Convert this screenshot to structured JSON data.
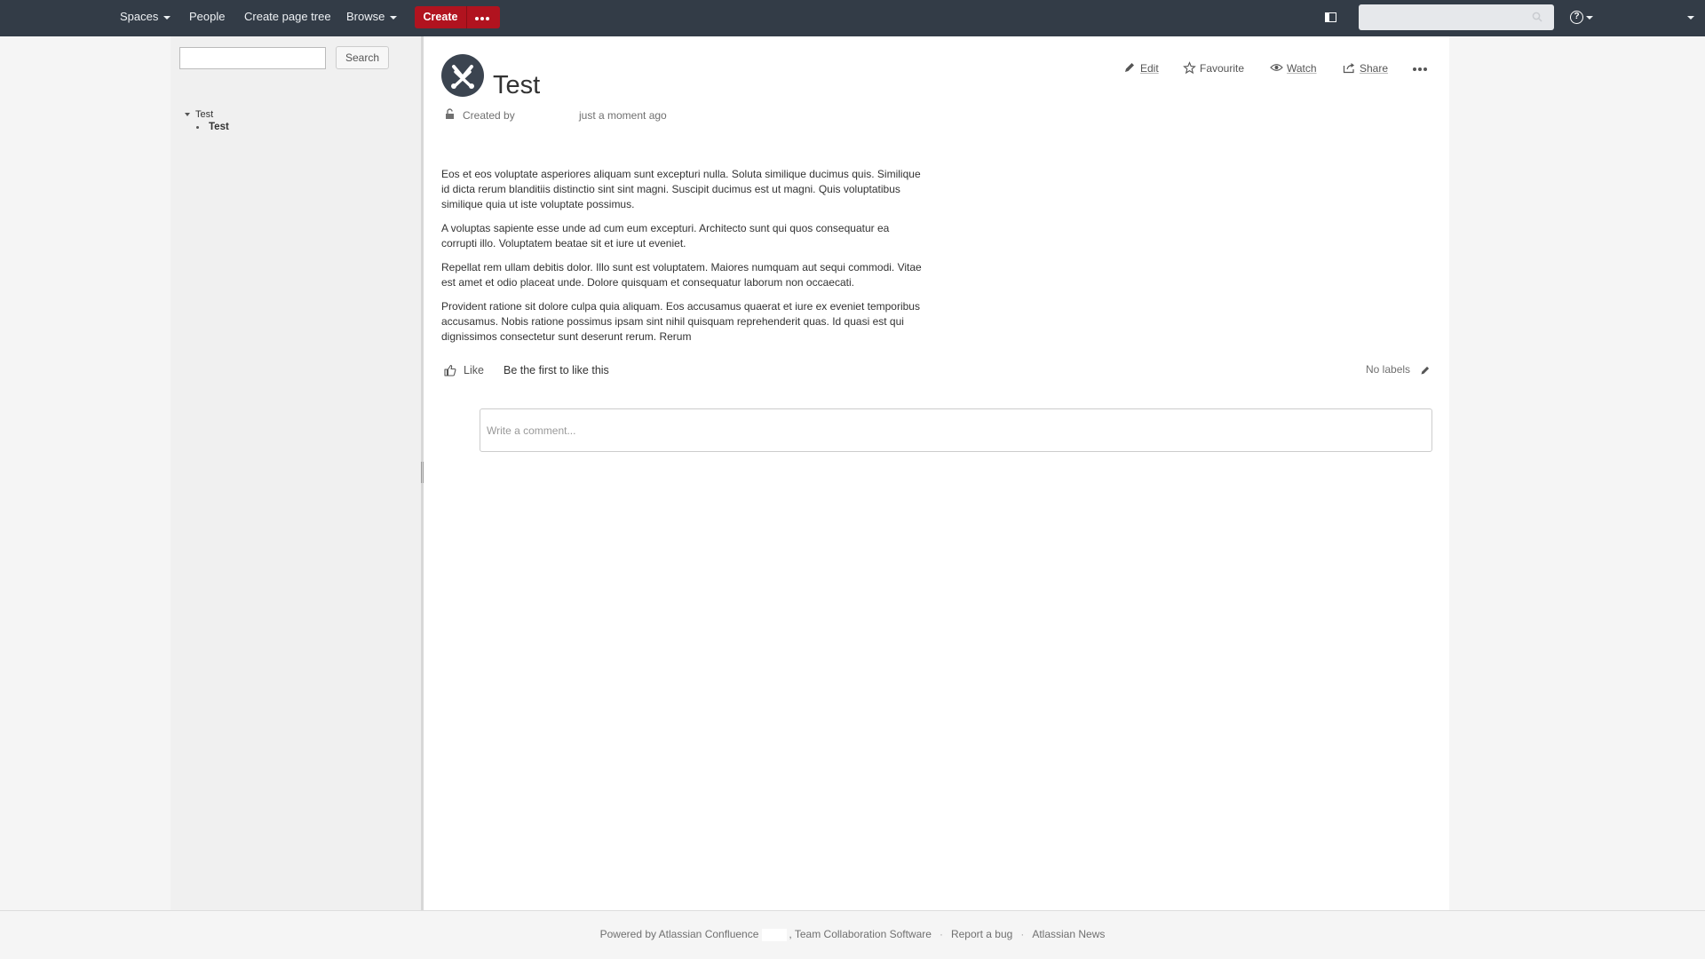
{
  "header": {
    "nav": {
      "spaces": "Spaces",
      "people": "People",
      "create_page_tree": "Create page tree",
      "browse": "Browse"
    },
    "create_label": "Create",
    "search_placeholder": "",
    "icons": {
      "sidebar_toggle": "sidebar-toggle-icon",
      "search": "search-icon",
      "help": "help-icon",
      "help_glyph": "?",
      "more": "more-icon"
    }
  },
  "sidebar": {
    "search_button": "Search",
    "tree": {
      "parent": "Test",
      "child": "Test"
    }
  },
  "page": {
    "title": "Test",
    "byline_created_by": "Created by",
    "byline_time": "just a moment ago",
    "actions": {
      "edit": "Edit",
      "favourite": "Favourite",
      "watch": "Watch",
      "share": "Share"
    },
    "paragraphs": [
      "Eos et eos voluptate asperiores aliquam sunt excepturi nulla. Soluta similique ducimus quis. Similique id dicta rerum blanditiis distinctio sint sint magni. Suscipit ducimus est ut magni. Quis voluptatibus similique quia ut iste voluptate possimus.",
      "A voluptas sapiente esse unde ad cum eum excepturi. Architecto sunt qui quos consequatur ea corrupti illo. Voluptatem beatae sit et iure ut eveniet.",
      "Repellat rem ullam debitis dolor. Illo sunt est voluptatem. Maiores numquam aut sequi commodi. Vitae est amet et odio placeat unde. Dolore quisquam et consequatur laborum non occaecati.",
      "Provident ratione sit dolore culpa quia aliquam. Eos accusamus quaerat et iure ex eveniet temporibus accusamus. Nobis ratione possimus ipsam sint nihil quisquam reprehenderit quas. Id quasi est qui dignissimos consectetur sunt deserunt rerum. Rerum"
    ],
    "like_label": "Like",
    "like_summary": "Be the first to like this",
    "labels_text": "No labels",
    "comment_placeholder": "Write a comment..."
  },
  "footer": {
    "powered_by": "Powered by Atlassian Confluence",
    "team_software": ", Team Collaboration Software",
    "report_bug": "Report a bug",
    "news": "Atlassian News",
    "separator": "·"
  },
  "colors": {
    "topbar": "#333c47",
    "create_button": "#b1131f",
    "sidebar": "#f0f0f0",
    "content_bg": "#ffffff"
  }
}
